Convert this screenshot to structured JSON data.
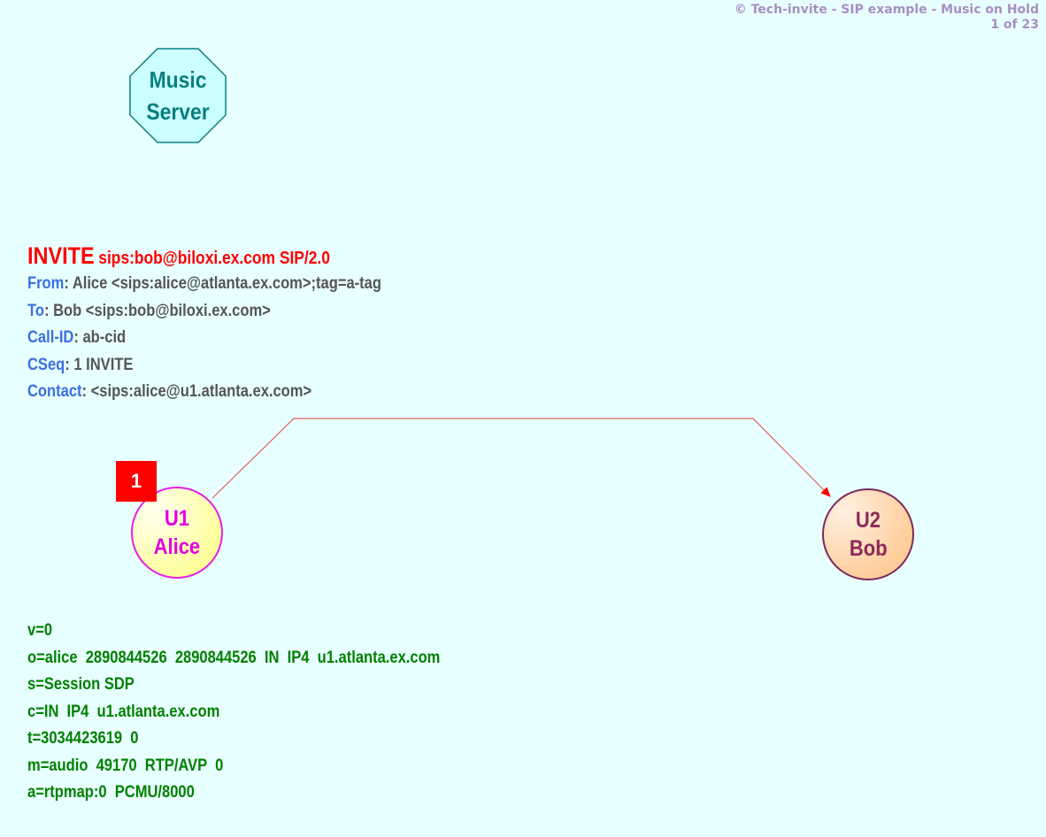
{
  "header": {
    "title": "© Tech-invite - SIP example - Music on Hold",
    "page": "1 of 23"
  },
  "music_server": {
    "line1": "Music",
    "line2": "Server"
  },
  "sip_message": {
    "method": "INVITE",
    "request_uri": "sips:bob@biloxi.ex.com SIP/2.0",
    "headers": [
      {
        "name": "From",
        "value": "Alice <sips:alice@atlanta.ex.com>;tag=a-tag"
      },
      {
        "name": "To",
        "value": "Bob <sips:bob@biloxi.ex.com>"
      },
      {
        "name": "Call-ID",
        "value": "ab-cid"
      },
      {
        "name": "CSeq",
        "value": "1 INVITE"
      },
      {
        "name": "Contact",
        "value": "<sips:alice@u1.atlanta.ex.com>"
      }
    ]
  },
  "step": {
    "number": "1"
  },
  "nodes": {
    "alice": {
      "line1": "U1",
      "line2": "Alice"
    },
    "bob": {
      "line1": "U2",
      "line2": "Bob"
    }
  },
  "sdp": [
    "v=0",
    "o=alice  2890844526  2890844526  IN  IP4  u1.atlanta.ex.com",
    "s=Session SDP",
    "c=IN  IP4  u1.atlanta.ex.com",
    "t=3034423619  0",
    "m=audio  49170  RTP/AVP  0",
    "a=rtpmap:0  PCMU/8000"
  ],
  "colors": {
    "background": "#e8ffff",
    "method": "#ff0000",
    "header_name": "#3a6fe0",
    "sdp_text": "#008000",
    "arrow": "#e06060"
  }
}
